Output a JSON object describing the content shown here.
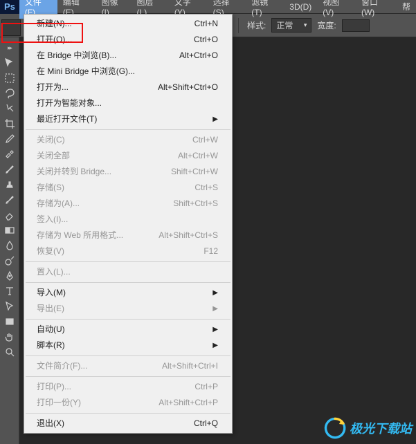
{
  "menubar": {
    "logo": "Ps",
    "items": [
      "文件(F)",
      "编辑(E)",
      "图像(I)",
      "图层(L)",
      "文字(Y)",
      "选择(S)",
      "滤镜(T)",
      "3D(D)",
      "视图(V)",
      "窗口(W)",
      "帮"
    ]
  },
  "options": {
    "style_label": "样式:",
    "style_value": "正常",
    "width_label": "宽度:"
  },
  "dropdown": {
    "items": [
      {
        "label": "新建(N)...",
        "shortcut": "Ctrl+N",
        "disabled": false
      },
      {
        "label": "打开(O)...",
        "shortcut": "Ctrl+O",
        "disabled": false
      },
      {
        "label": "在 Bridge 中浏览(B)...",
        "shortcut": "Alt+Ctrl+O",
        "disabled": false
      },
      {
        "label": "在 Mini Bridge 中浏览(G)...",
        "shortcut": "",
        "disabled": false
      },
      {
        "label": "打开为...",
        "shortcut": "Alt+Shift+Ctrl+O",
        "disabled": false
      },
      {
        "label": "打开为智能对象...",
        "shortcut": "",
        "disabled": false
      },
      {
        "label": "最近打开文件(T)",
        "shortcut": "",
        "disabled": false,
        "submenu": true
      },
      {
        "sep": true
      },
      {
        "label": "关闭(C)",
        "shortcut": "Ctrl+W",
        "disabled": true
      },
      {
        "label": "关闭全部",
        "shortcut": "Alt+Ctrl+W",
        "disabled": true
      },
      {
        "label": "关闭并转到 Bridge...",
        "shortcut": "Shift+Ctrl+W",
        "disabled": true
      },
      {
        "label": "存储(S)",
        "shortcut": "Ctrl+S",
        "disabled": true
      },
      {
        "label": "存储为(A)...",
        "shortcut": "Shift+Ctrl+S",
        "disabled": true
      },
      {
        "label": "签入(I)...",
        "shortcut": "",
        "disabled": true
      },
      {
        "label": "存储为 Web 所用格式...",
        "shortcut": "Alt+Shift+Ctrl+S",
        "disabled": true
      },
      {
        "label": "恢复(V)",
        "shortcut": "F12",
        "disabled": true
      },
      {
        "sep": true
      },
      {
        "label": "置入(L)...",
        "shortcut": "",
        "disabled": true
      },
      {
        "sep": true
      },
      {
        "label": "导入(M)",
        "shortcut": "",
        "disabled": false,
        "submenu": true
      },
      {
        "label": "导出(E)",
        "shortcut": "",
        "disabled": true,
        "submenu": true
      },
      {
        "sep": true
      },
      {
        "label": "自动(U)",
        "shortcut": "",
        "disabled": false,
        "submenu": true
      },
      {
        "label": "脚本(R)",
        "shortcut": "",
        "disabled": false,
        "submenu": true
      },
      {
        "sep": true
      },
      {
        "label": "文件简介(F)...",
        "shortcut": "Alt+Shift+Ctrl+I",
        "disabled": true
      },
      {
        "sep": true
      },
      {
        "label": "打印(P)...",
        "shortcut": "Ctrl+P",
        "disabled": true
      },
      {
        "label": "打印一份(Y)",
        "shortcut": "Alt+Shift+Ctrl+P",
        "disabled": true
      },
      {
        "sep": true
      },
      {
        "label": "退出(X)",
        "shortcut": "Ctrl+Q",
        "disabled": false
      }
    ]
  },
  "tools": [
    "move",
    "marquee",
    "lasso",
    "quick-select",
    "crop",
    "eyedropper",
    "healing",
    "brush",
    "clone",
    "history-brush",
    "eraser",
    "gradient",
    "blur",
    "dodge",
    "pen",
    "type",
    "path-select",
    "rectangle",
    "hand",
    "zoom"
  ],
  "watermark": "极光下载站"
}
